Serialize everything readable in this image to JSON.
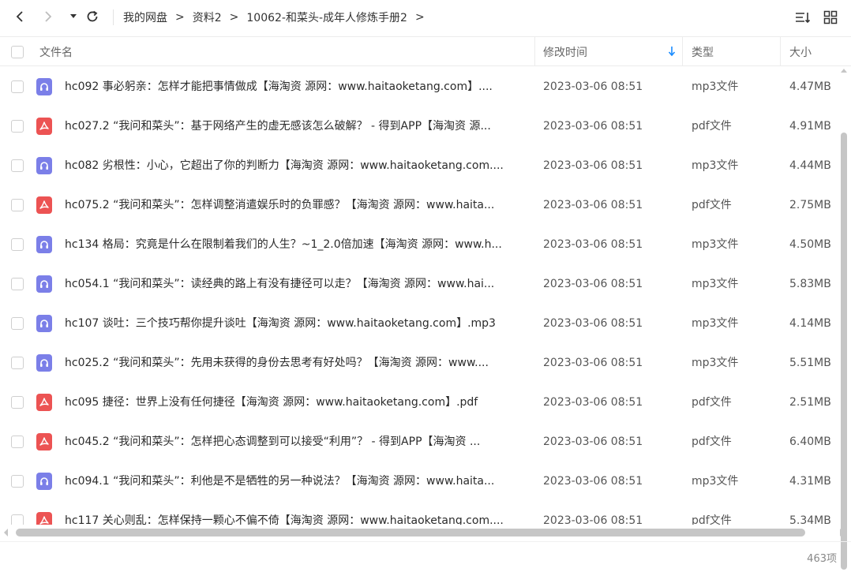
{
  "toolbar": {
    "back_icon": "chevron-left-icon",
    "forward_icon": "chevron-right-icon",
    "history_icon": "dropdown-caret-icon",
    "refresh_icon": "refresh-icon",
    "sort_icon": "sort-list-icon",
    "view_icon": "grid-view-icon"
  },
  "breadcrumb": {
    "items": [
      "我的网盘",
      "资料2",
      "10062-和菜头-成年人修炼手册2"
    ],
    "separator": ">"
  },
  "table": {
    "headers": {
      "name": "文件名",
      "modified": "修改时间",
      "type": "类型",
      "size": "大小"
    },
    "sort_column": "modified",
    "sort_direction": "descending",
    "rows": [
      {
        "icon": "mp3",
        "name": "hc092 事必躬亲：怎样才能把事情做成【海淘资 源网：www.haitaoketang.com】....",
        "time": "2023-03-06 08:51",
        "type": "mp3文件",
        "size": "4.47MB"
      },
      {
        "icon": "pdf",
        "name": "hc027.2 “我问和菜头”：基于网络产生的虚无感该怎么破解？ - 得到APP【海淘资 源...",
        "time": "2023-03-06 08:51",
        "type": "pdf文件",
        "size": "4.91MB"
      },
      {
        "icon": "mp3",
        "name": "hc082 劣根性：小心，它超出了你的判断力【海淘资 源网：www.haitaoketang.com....",
        "time": "2023-03-06 08:51",
        "type": "mp3文件",
        "size": "4.44MB"
      },
      {
        "icon": "pdf",
        "name": "hc075.2 “我问和菜头”：怎样调整消遣娱乐时的负罪感？【海淘资 源网：www.haita...",
        "time": "2023-03-06 08:51",
        "type": "pdf文件",
        "size": "2.75MB"
      },
      {
        "icon": "mp3",
        "name": "hc134 格局：究竟是什么在限制着我们的人生？~1_2.0倍加速【海淘资 源网：www.h...",
        "time": "2023-03-06 08:51",
        "type": "mp3文件",
        "size": "4.50MB"
      },
      {
        "icon": "mp3",
        "name": "hc054.1 “我问和菜头”：读经典的路上有没有捷径可以走？【海淘资 源网：www.hai...",
        "time": "2023-03-06 08:51",
        "type": "mp3文件",
        "size": "5.83MB"
      },
      {
        "icon": "mp3",
        "name": "hc107 谈吐：三个技巧帮你提升谈吐【海淘资 源网：www.haitaoketang.com】.mp3",
        "time": "2023-03-06 08:51",
        "type": "mp3文件",
        "size": "4.14MB"
      },
      {
        "icon": "mp3",
        "name": "hc025.2 “我问和菜头”：先用未获得的身份去思考有好处吗？【海淘资 源网：www....",
        "time": "2023-03-06 08:51",
        "type": "mp3文件",
        "size": "5.51MB"
      },
      {
        "icon": "pdf",
        "name": "hc095 捷径：世界上没有任何捷径【海淘资 源网：www.haitaoketang.com】.pdf",
        "time": "2023-03-06 08:51",
        "type": "pdf文件",
        "size": "2.51MB"
      },
      {
        "icon": "pdf",
        "name": "hc045.2 “我问和菜头”：怎样把心态调整到可以接受“利用”？ - 得到APP【海淘资 ...",
        "time": "2023-03-06 08:51",
        "type": "pdf文件",
        "size": "6.40MB"
      },
      {
        "icon": "mp3",
        "name": "hc094.1 “我问和菜头”：利他是不是牺牲的另一种说法？【海淘资 源网：www.haita...",
        "time": "2023-03-06 08:51",
        "type": "mp3文件",
        "size": "4.31MB"
      },
      {
        "icon": "pdf",
        "name": "hc117 关心则乱：怎样保持一颗心不偏不倚【海淘资 源网：www.haitaoketang.com....",
        "time": "2023-03-06 08:51",
        "type": "pdf文件",
        "size": "5.34MB"
      }
    ]
  },
  "footer": {
    "count": "463项"
  },
  "colors": {
    "mp3_icon": "#7b7fe8",
    "pdf_icon": "#ec5353",
    "sort_arrow": "#1a8cff"
  }
}
